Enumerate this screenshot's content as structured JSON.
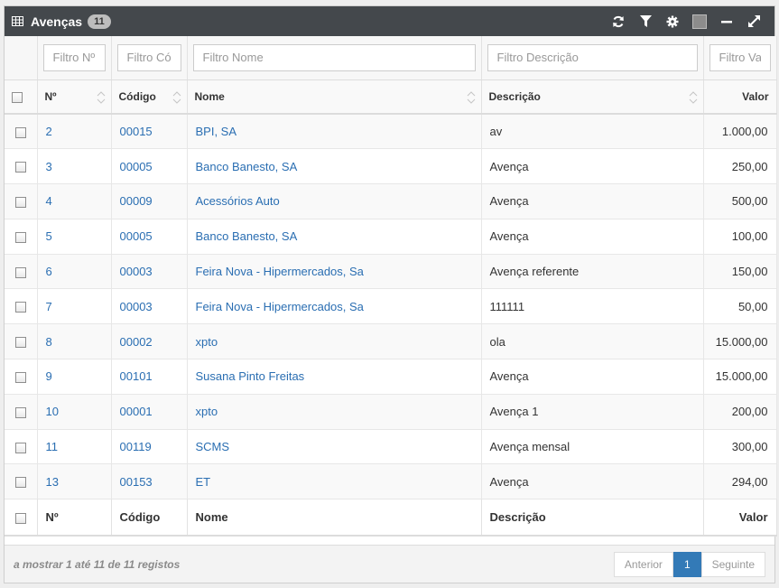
{
  "widget": {
    "title": "Avenças",
    "count": "11",
    "icons": [
      "table-icon",
      "refresh-icon",
      "filter-icon",
      "gear-icon",
      "color-swatch",
      "minimize-icon",
      "expand-icon"
    ],
    "swatch_color": "#8c8c8c"
  },
  "filters": {
    "numero": "Filtro Nº",
    "codigo": "Filtro Código",
    "nome": "Filtro Nome",
    "descricao": "Filtro Descrição",
    "valor": "Filtro Valor"
  },
  "columns": {
    "numero": "Nº",
    "codigo": "Código",
    "nome": "Nome",
    "descricao": "Descrição",
    "valor": "Valor"
  },
  "rows": [
    {
      "numero": "2",
      "codigo": "00015",
      "nome": "BPI, SA",
      "descricao": "av",
      "valor": "1.000,00"
    },
    {
      "numero": "3",
      "codigo": "00005",
      "nome": "Banco Banesto, SA",
      "descricao": "Avença",
      "valor": "250,00"
    },
    {
      "numero": "4",
      "codigo": "00009",
      "nome": "Acessórios Auto",
      "descricao": "Avença",
      "valor": "500,00"
    },
    {
      "numero": "5",
      "codigo": "00005",
      "nome": "Banco Banesto, SA",
      "descricao": "Avença",
      "valor": "100,00"
    },
    {
      "numero": "6",
      "codigo": "00003",
      "nome": "Feira Nova - Hipermercados, Sa",
      "descricao": "Avença referente",
      "valor": "150,00"
    },
    {
      "numero": "7",
      "codigo": "00003",
      "nome": "Feira Nova - Hipermercados, Sa",
      "descricao": "111111",
      "valor": "50,00"
    },
    {
      "numero": "8",
      "codigo": "00002",
      "nome": "xpto",
      "descricao": "ola",
      "valor": "15.000,00"
    },
    {
      "numero": "9",
      "codigo": "00101",
      "nome": "Susana Pinto Freitas",
      "descricao": "Avença",
      "valor": "15.000,00"
    },
    {
      "numero": "10",
      "codigo": "00001",
      "nome": "xpto",
      "descricao": "Avença 1",
      "valor": "200,00"
    },
    {
      "numero": "11",
      "codigo": "00119",
      "nome": "SCMS",
      "descricao": "Avença mensal",
      "valor": "300,00"
    },
    {
      "numero": "13",
      "codigo": "00153",
      "nome": "ET",
      "descricao": "Avença",
      "valor": "294,00"
    }
  ],
  "footer": {
    "info": "a mostrar 1 até 11 de 11 registos",
    "prev": "Anterior",
    "page": "1",
    "next": "Seguinte"
  },
  "colors": {
    "header_bg": "#44484c",
    "link": "#2a6eb2",
    "active_page": "#337ab7"
  }
}
